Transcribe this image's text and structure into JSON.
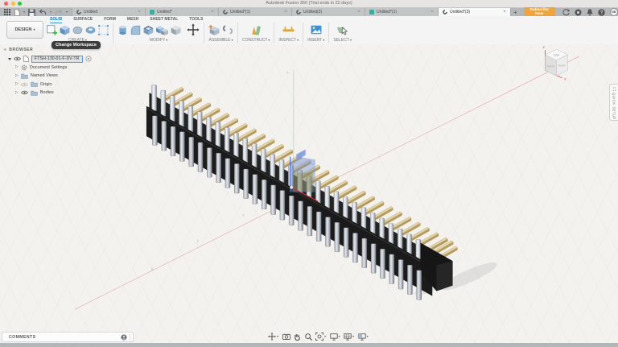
{
  "window": {
    "title": "Autodesk Fusion 360 (Trial ends in 22 days)"
  },
  "glyphs": {
    "caret": "▾",
    "close": "×",
    "add": "+",
    "collapse": "«",
    "tri_closed": "▷"
  },
  "tabbar": {
    "tabs": [
      {
        "label": "Untitled"
      },
      {
        "label": "Untitled*"
      },
      {
        "label": "Untitled*(1)"
      },
      {
        "label": "Untitled(2)"
      },
      {
        "label": "Untitled*(1)"
      },
      {
        "label": "Untitled*(3)"
      }
    ],
    "subscribe_label": "Subscribe Now",
    "avatar_initials": "NB"
  },
  "ribbon": {
    "workspace_button": "DESIGN",
    "tabs": [
      "SOLID",
      "SURFACE",
      "FORM",
      "MESH",
      "SHEET METAL",
      "TOOLS"
    ],
    "active_tab": "SOLID",
    "groups": [
      "CREATE",
      "MODIFY",
      "ASSEMBLE",
      "CONSTRUCT",
      "INSPECT",
      "INSERT",
      "SELECT"
    ],
    "tooltip": "Change Workspace"
  },
  "browser": {
    "header": "BROWSER",
    "root_label": "FTSH-130-01-F-DV-TR",
    "items": [
      {
        "label": "Document Settings"
      },
      {
        "label": "Named Views"
      },
      {
        "label": "Origin"
      },
      {
        "label": "Bodies"
      }
    ]
  },
  "viewcube": {
    "top": "TOP",
    "front": "FRONT",
    "right": "RIGHT",
    "axis_x": "X",
    "axis_z": "Z"
  },
  "side_tab": "QUICK SETUP",
  "comments": {
    "label": "COMMENTS"
  },
  "canvas": {
    "grid_labels": [
      "5",
      "5",
      "5",
      "5"
    ]
  },
  "model": {
    "part_number": "FTSH-130-01-F-DV-TR",
    "rows": 2,
    "pins_per_row": 30
  },
  "colors": {
    "accent_blue": "#0a7ac4",
    "subscribe_orange": "#f0a43c",
    "body_black": "#1b1b1b",
    "shroud_black": "#242424",
    "tail_top": "#e3d3a3",
    "tail_side": "#b59a60",
    "axis_red": "#cf2e2e",
    "axis_green": "#609c60",
    "axis_blue": "#3b5bd6",
    "selection_blue": "rgba(115,142,205,0.42)",
    "pink_line": "#e5a5a5"
  }
}
